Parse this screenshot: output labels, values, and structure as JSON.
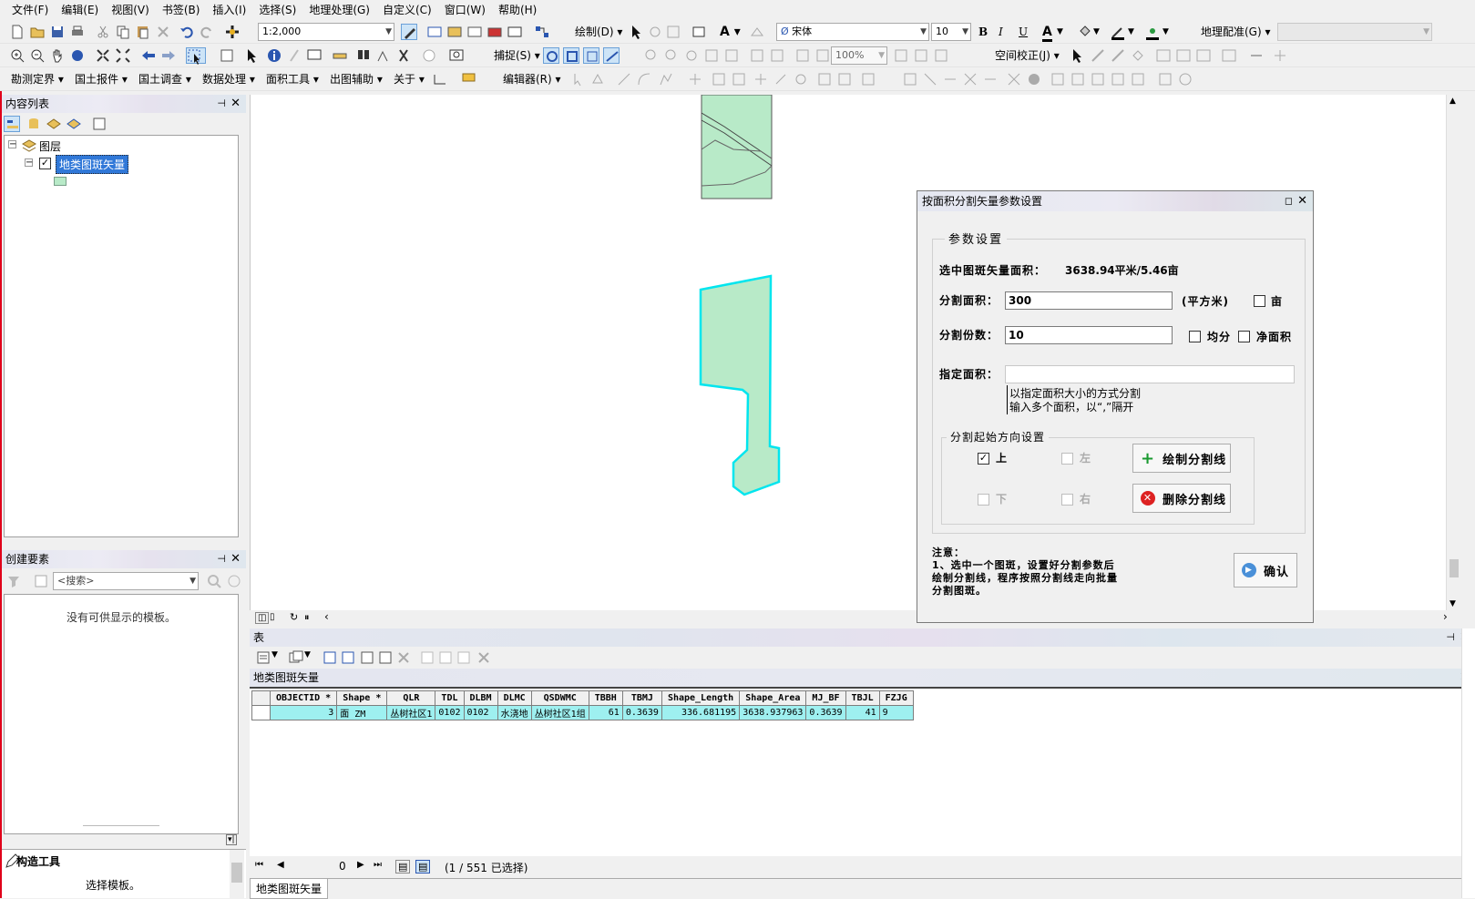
{
  "menu": [
    "文件(F)",
    "编辑(E)",
    "视图(V)",
    "书签(B)",
    "插入(I)",
    "选择(S)",
    "地理处理(G)",
    "自定义(C)",
    "窗口(W)",
    "帮助(H)"
  ],
  "toolbar1": {
    "scale": "1:2,000",
    "draw_label": "绘制(D)",
    "font_name": "宋体",
    "font_size": "10",
    "bold": "B",
    "italic": "I",
    "underline": "U",
    "georef_label": "地理配准(G)"
  },
  "toolbar2": {
    "snap_label": "捕捉(S)",
    "zoom_pct": "100%",
    "spatial_adjust_label": "空间校正(J)"
  },
  "toolbar3": {
    "items": [
      "勘测定界",
      "国土报件",
      "国土调查",
      "数据处理",
      "面积工具",
      "出图辅助",
      "关于"
    ],
    "editor_label": "编辑器(R)"
  },
  "toc": {
    "title": "内容列表",
    "root_label": "图层",
    "layer_label": "地类图斑矢量",
    "layer_color": "#b8eac8"
  },
  "create_features": {
    "title": "创建要素",
    "search_placeholder": "<搜索>",
    "empty_text": "没有可供显示的模板。"
  },
  "construct_tools": {
    "title": "构造工具",
    "hint": "选择模板。"
  },
  "map": {
    "polygon_fill": "#b8eac8",
    "selection_color": "#00e5ee"
  },
  "table_pane": {
    "title": "表",
    "tab_name": "地类图斑矢量",
    "columns": [
      "OBJECTID *",
      "Shape *",
      "QLR",
      "TDL",
      "DLBM",
      "DLMC",
      "QSDWMC",
      "TBBH",
      "TBMJ",
      "Shape_Length",
      "Shape_Area",
      "MJ_BF",
      "TBJL",
      "FZJG"
    ],
    "row": [
      "3",
      "面 ZM",
      "丛树社区1",
      "0102",
      "0102",
      "水浇地",
      "丛树社区1组",
      "61",
      "0.3639",
      "336.681195",
      "3638.937963",
      "0.3639",
      "41",
      "9"
    ],
    "record_pos": "0",
    "record_status": "(1 / 551 已选择)",
    "bottom_tab": "地类图斑矢量"
  },
  "dialog": {
    "title": "按面积分割矢量参数设置",
    "group_title": "参数设置",
    "area_label": "选中图斑矢量面积：",
    "area_value": "3638.94平米/5.46亩",
    "split_area_label": "分割面积：",
    "split_area_value": "300",
    "unit_label": "(平方米)",
    "mu_label": "亩",
    "split_count_label": "分割份数：",
    "split_count_value": "10",
    "equal_label": "均分",
    "net_label": "净面积",
    "specify_label": "指定面积：",
    "specify_hint1": "以指定面积大小的方式分割",
    "specify_hint2": "输入多个面积，以“,”隔开",
    "direction_group": "分割起始方向设置",
    "dir_up": "上",
    "dir_left": "左",
    "dir_down": "下",
    "dir_right": "右",
    "draw_btn": "绘制分割线",
    "delete_btn": "删除分割线",
    "note_title": "注意：",
    "note_1": "1、选中一个图斑，设置好分割参数后",
    "note_2": "绘制分割线，程序按照分割线走向批量",
    "note_3": "分割图斑。",
    "confirm_btn": "确认"
  }
}
